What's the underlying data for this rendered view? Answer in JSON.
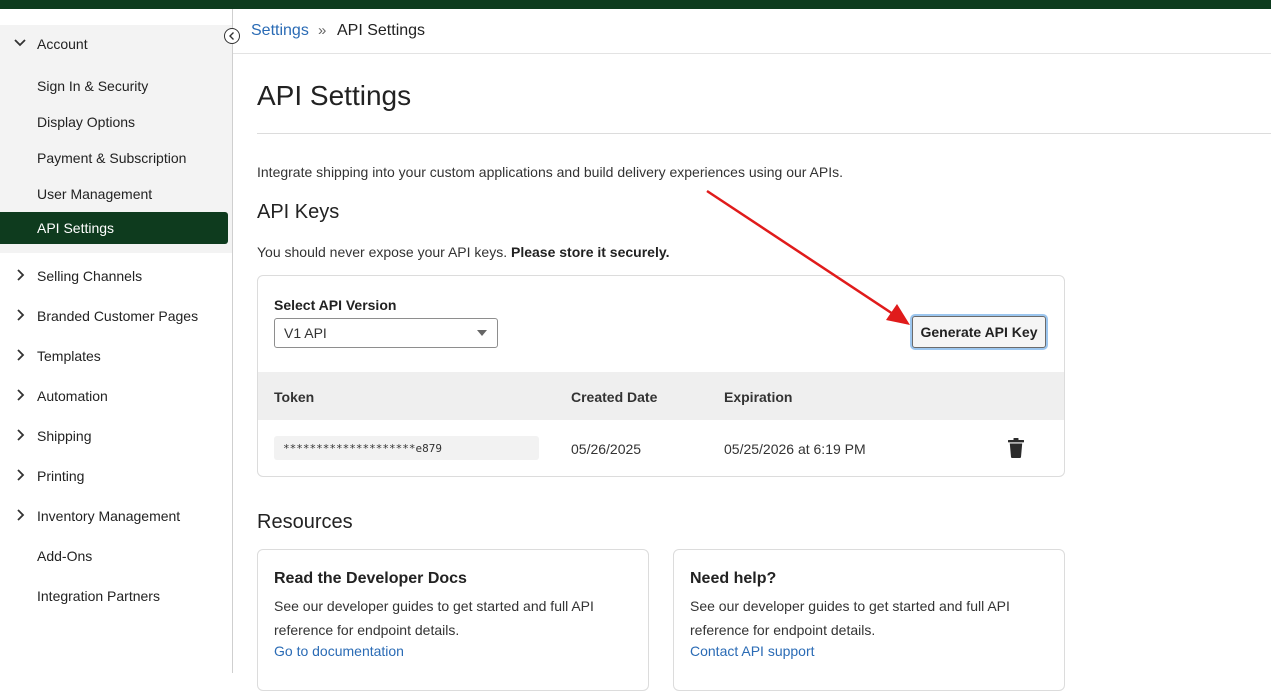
{
  "sidebar": {
    "account": {
      "label": "Account",
      "icon": "chevron-down-icon"
    },
    "account_items": [
      "Sign In & Security",
      "Display Options",
      "Payment & Subscription",
      "User Management"
    ],
    "active_item": "API Settings",
    "groups": [
      "Selling Channels",
      "Branded Customer Pages",
      "Templates",
      "Automation",
      "Shipping",
      "Printing",
      "Inventory Management"
    ],
    "plain_items": [
      "Add-Ons",
      "Integration Partners"
    ],
    "collapse_icon": "chevron-left-icon"
  },
  "breadcrumb": {
    "parent": "Settings",
    "separator": "»",
    "current": "API Settings"
  },
  "page": {
    "title": "API Settings",
    "intro": "Integrate shipping into your custom applications and build delivery experiences using our APIs.",
    "api_keys_heading": "API Keys",
    "warning_text": "You should never expose your API keys.",
    "warning_bold": "Please store it securely."
  },
  "api_card": {
    "select_label": "Select API Version",
    "select_value": "V1 API",
    "generate_button": "Generate API Key",
    "columns": [
      "Token",
      "Created Date",
      "Expiration"
    ],
    "rows": [
      {
        "token": "********************e879",
        "created": "05/26/2025",
        "expiration": "05/25/2026 at 6:19 PM",
        "action_icon": "trash-icon"
      }
    ]
  },
  "resources": {
    "heading": "Resources",
    "cards": [
      {
        "title": "Read the Developer Docs",
        "desc": "See our developer guides to get started and full API reference for endpoint details.",
        "link": "Go to documentation"
      },
      {
        "title": "Need help?",
        "desc": "See our developer guides to get started and full API reference for endpoint details.",
        "link": "Contact API support"
      }
    ]
  },
  "colors": {
    "brand_dark_green": "#0e3b1e",
    "link_blue": "#2a6bb5",
    "annotation_red": "#e01b1b"
  }
}
